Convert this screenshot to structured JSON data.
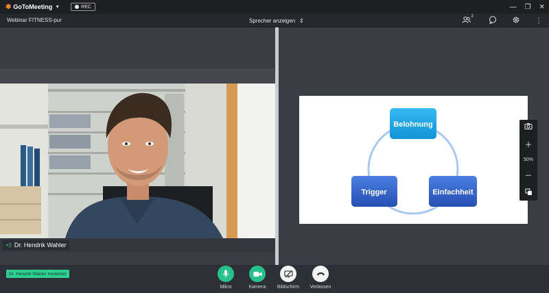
{
  "titlebar": {
    "brand": "GoToMeeting",
    "rec_label": "REC"
  },
  "header": {
    "webinar_title": "Webinar FITNESS-pur",
    "view_select": "Sprecher anzeigen",
    "attendee_count": "2"
  },
  "left": {
    "speaker_name": "Dr. Hendrik Wahler"
  },
  "slide": {
    "top_node": "Belohnung",
    "left_node": "Trigger",
    "right_node": "Einfachheit"
  },
  "zoom": {
    "level": "50%"
  },
  "footer": {
    "moderator": "Dr. Hendrik Wahler moderiert",
    "buttons": {
      "mic": "Mikro",
      "camera": "Kamera",
      "screen": "Bildschirm",
      "leave": "Verlassen"
    }
  },
  "colors": {
    "accent_green": "#27c28c",
    "brand_orange": "#f68d2e",
    "node_top": "#1aa7e8",
    "node_bottom": "#2f62c9"
  }
}
